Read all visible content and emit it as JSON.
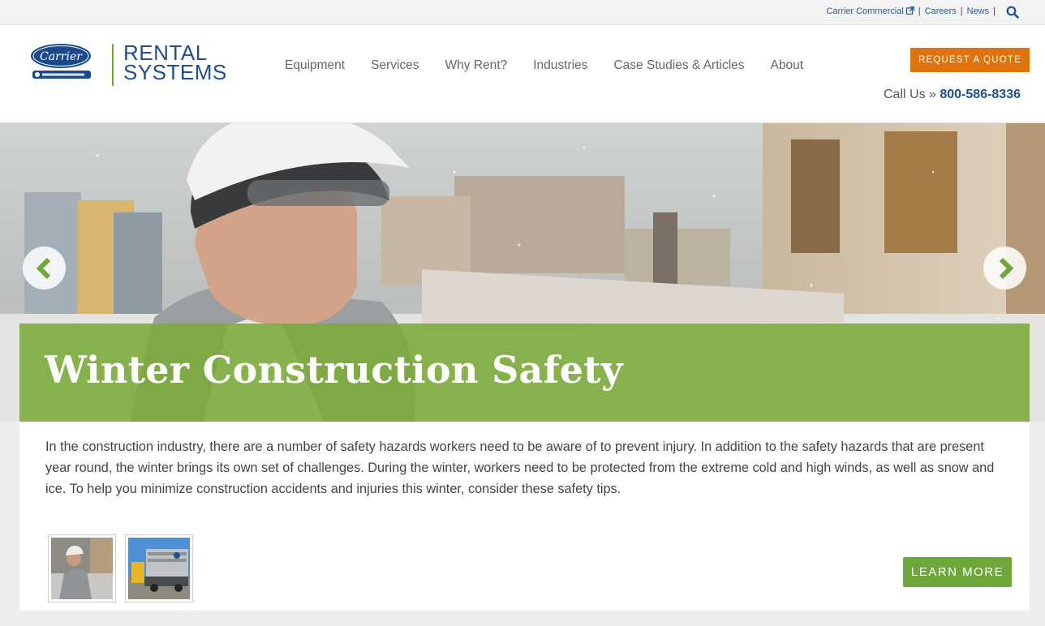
{
  "utility": {
    "links": [
      {
        "label": "Carrier Commercial",
        "external": true
      },
      {
        "label": "Careers"
      },
      {
        "label": "News"
      }
    ],
    "separator": "|",
    "search_icon": "search-icon"
  },
  "header": {
    "logo_alt": "Carrier",
    "brand_line1": "RENTAL",
    "brand_line2": "SYSTEMS",
    "nav": [
      "Equipment",
      "Services",
      "Why Rent?",
      "Industries",
      "Case Studies & Articles",
      "About"
    ],
    "quote_label": "REQUEST A QUOTE",
    "call_prefix": "Call Us »",
    "phone": "800-586-8336"
  },
  "hero": {
    "title": "Winter Construction Safety",
    "prev_icon": "chevron-left-icon",
    "next_icon": "chevron-right-icon"
  },
  "content": {
    "intro": "In the construction industry, there are a number of safety hazards workers need to be aware of to prevent injury. In addition to the safety hazards that are present year round, the winter brings its own set of challenges. During the winter, workers need to be protected from the extreme cold and high winds, as well as snow and ice. To help you minimize construction accidents and injuries this winter, consider these safety tips.",
    "learn_more_label": "LEARN MORE"
  },
  "colors": {
    "brand_blue": "#1f4f8f",
    "accent_orange": "#e0730b",
    "accent_green": "#6fa83a"
  }
}
